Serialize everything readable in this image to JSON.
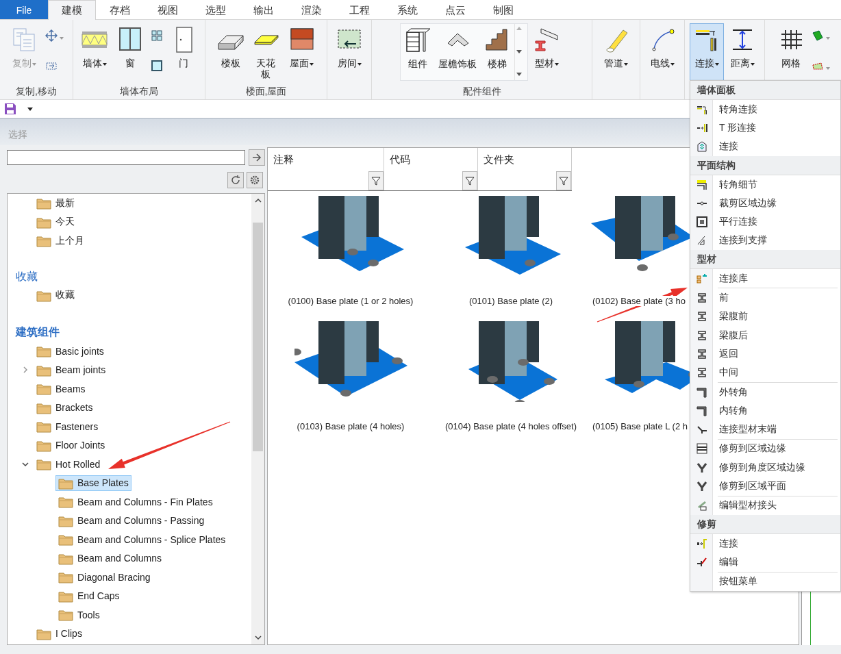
{
  "tabs": [
    {
      "label": "File",
      "kind": "file",
      "selected": false
    },
    {
      "label": "建模",
      "kind": "tab",
      "selected": true
    },
    {
      "label": "存档",
      "kind": "tab",
      "selected": false
    },
    {
      "label": "视图",
      "kind": "tab",
      "selected": false
    },
    {
      "label": "选型",
      "kind": "tab",
      "selected": false
    },
    {
      "label": "输出",
      "kind": "tab",
      "selected": false
    },
    {
      "label": "渲染",
      "kind": "tab",
      "selected": false
    },
    {
      "label": "工程",
      "kind": "tab",
      "selected": false
    },
    {
      "label": "系统",
      "kind": "tab",
      "selected": false
    },
    {
      "label": "点云",
      "kind": "tab",
      "selected": false
    },
    {
      "label": "制图",
      "kind": "tab",
      "selected": false
    }
  ],
  "ribbon": [
    {
      "label": "复制,移动",
      "items": [
        {
          "kind": "large",
          "label": "复制",
          "dropdown": true,
          "disabled": true,
          "selected": false
        },
        {
          "kind": "small",
          "dropdown": true
        },
        {
          "kind": "small",
          "dropdown": false
        }
      ]
    },
    {
      "label": "墙体布局",
      "items": [
        {
          "kind": "large",
          "label": "墙体",
          "dropdown": true,
          "disabled": false,
          "selected": false
        },
        {
          "kind": "large",
          "label": "窗",
          "dropdown": false,
          "disabled": false,
          "selected": false
        },
        {
          "kind": "small",
          "dropdown": false
        },
        {
          "kind": "small",
          "dropdown": false
        },
        {
          "kind": "large",
          "label": "门",
          "dropdown": false,
          "disabled": false,
          "selected": false
        }
      ]
    },
    {
      "label": "楼面,屋面",
      "items": [
        {
          "kind": "large",
          "label": "楼板",
          "dropdown": false,
          "disabled": false,
          "selected": false
        },
        {
          "kind": "large",
          "label": "天花板",
          "dropdown": false,
          "disabled": false,
          "selected": false
        },
        {
          "kind": "large",
          "label": "屋面",
          "dropdown": true,
          "disabled": false,
          "selected": false
        }
      ]
    },
    {
      "items": [
        {
          "kind": "large",
          "label": "房间",
          "dropdown": true,
          "disabled": false,
          "selected": false
        }
      ]
    },
    {
      "label": "配件组件",
      "items": [
        {
          "kind": "gallery",
          "entries": [
            {
              "label": "组件"
            },
            {
              "label": "屋檐饰板"
            },
            {
              "label": "楼梯"
            }
          ]
        },
        {
          "kind": "large",
          "label": "型材",
          "dropdown": true,
          "disabled": false,
          "selected": false
        }
      ]
    },
    {
      "items": [
        {
          "kind": "large",
          "label": "管道",
          "dropdown": true,
          "disabled": false,
          "selected": false
        }
      ]
    },
    {
      "items": [
        {
          "kind": "large",
          "label": "电线",
          "dropdown": true,
          "disabled": false,
          "selected": false
        }
      ]
    },
    {
      "items": [
        {
          "kind": "large",
          "label": "连接",
          "dropdown": true,
          "disabled": false,
          "selected": true
        },
        {
          "kind": "large",
          "label": "距离",
          "dropdown": true,
          "disabled": false,
          "selected": false
        }
      ]
    },
    {
      "items": [
        {
          "kind": "large",
          "label": "网格",
          "dropdown": false,
          "disabled": false,
          "selected": false
        },
        {
          "kind": "small",
          "dropdown": true
        },
        {
          "kind": "small",
          "dropdown": true
        }
      ]
    }
  ],
  "panel": {
    "title": "选择"
  },
  "tree": {
    "sections": [
      {
        "items": [
          {
            "label": "最新",
            "selected": false
          },
          {
            "label": "今天",
            "selected": false
          },
          {
            "label": "上个月",
            "selected": false
          }
        ]
      },
      {
        "title": "收藏",
        "bold": false,
        "items": [
          {
            "label": "收藏",
            "selected": false
          }
        ]
      },
      {
        "title": "建筑组件",
        "bold": true,
        "items": [
          {
            "label": "Basic joints",
            "selected": false
          },
          {
            "label": "Beam joints",
            "selected": false,
            "expanded": false
          },
          {
            "label": "Beams",
            "selected": false
          },
          {
            "label": "Brackets",
            "selected": false
          },
          {
            "label": "Fasteners",
            "selected": false
          },
          {
            "label": "Floor Joints",
            "selected": false
          },
          {
            "label": "Hot Rolled",
            "selected": false,
            "expanded": true,
            "children": [
              {
                "label": "Base Plates",
                "selected": true
              },
              {
                "label": "Beam and Columns - Fin Plates",
                "selected": false
              },
              {
                "label": "Beam and Columns - Passing",
                "selected": false
              },
              {
                "label": "Beam and Columns - Splice Plates",
                "selected": false
              },
              {
                "label": "Beam and Columns",
                "selected": false
              },
              {
                "label": "Diagonal Bracing",
                "selected": false
              },
              {
                "label": "End Caps",
                "selected": false
              },
              {
                "label": "Tools",
                "selected": false
              }
            ]
          },
          {
            "label": "I Clips",
            "selected": false
          }
        ]
      }
    ]
  },
  "gallery": {
    "columns": [
      {
        "label": "注释"
      },
      {
        "label": "代码"
      },
      {
        "label": "文件夹"
      }
    ],
    "items": [
      {
        "label": "(0100) Base plate (1 or 2 holes)"
      },
      {
        "label": "(0101) Base plate (2)"
      },
      {
        "label": "(0102) Base plate (3 ho"
      },
      {
        "label": "(0103) Base plate (4 holes)"
      },
      {
        "label": "(0104) Base plate (4 holes offset)"
      },
      {
        "label": "(0105) Base plate L (2 h"
      }
    ]
  },
  "menu": {
    "sections": [
      {
        "title": "墙体面板",
        "groups": [
          [
            {
              "label": "转角连接"
            },
            {
              "label": "T 形连接"
            },
            {
              "label": "连接"
            }
          ]
        ]
      },
      {
        "title": "平面结构",
        "groups": [
          [
            {
              "label": "转角细节"
            },
            {
              "label": "裁剪区域边缘"
            },
            {
              "label": "平行连接"
            },
            {
              "label": "连接到支撑"
            }
          ]
        ]
      },
      {
        "title": "型材",
        "groups": [
          [
            {
              "label": "连接库"
            }
          ],
          [
            {
              "label": "前"
            },
            {
              "label": "梁腹前"
            },
            {
              "label": "梁腹后"
            },
            {
              "label": "返回"
            },
            {
              "label": "中间"
            }
          ],
          [
            {
              "label": "外转角"
            },
            {
              "label": "内转角"
            },
            {
              "label": "连接型材末端"
            }
          ],
          [
            {
              "label": "修剪到区域边缘"
            },
            {
              "label": "修剪到角度区域边缘"
            },
            {
              "label": "修剪到区域平面"
            }
          ],
          [
            {
              "label": "编辑型材接头"
            }
          ]
        ]
      },
      {
        "title": "修剪",
        "groups": [
          [
            {
              "label": "连接"
            },
            {
              "label": "编辑"
            }
          ],
          [
            {
              "label": "按钮菜单"
            }
          ]
        ]
      }
    ]
  }
}
